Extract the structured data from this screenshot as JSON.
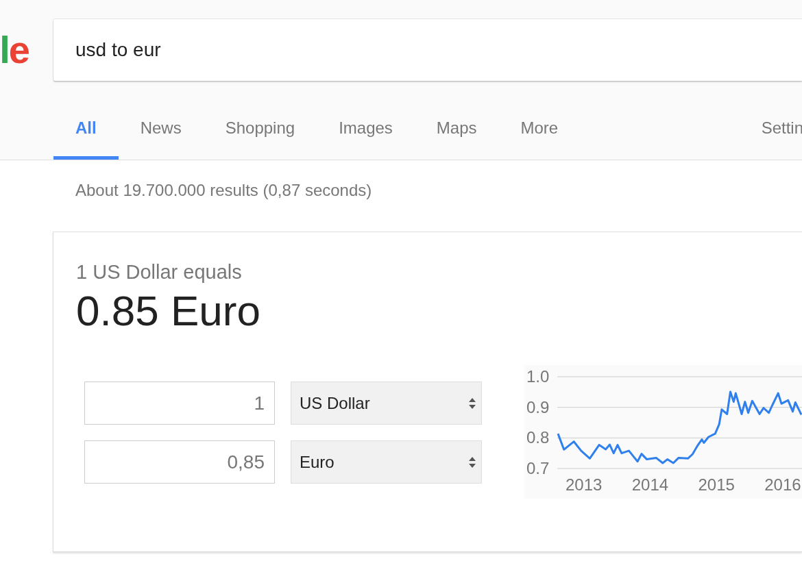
{
  "logo": {
    "text": "le"
  },
  "search": {
    "value": "usd to eur"
  },
  "tabs": [
    {
      "label": "All",
      "selected": true
    },
    {
      "label": "News",
      "selected": false
    },
    {
      "label": "Shopping",
      "selected": false
    },
    {
      "label": "Images",
      "selected": false
    },
    {
      "label": "Maps",
      "selected": false
    },
    {
      "label": "More",
      "selected": false
    }
  ],
  "settings": "Settin",
  "result_stats": "About 19.700.000 results (0,87 seconds)",
  "converter": {
    "equals": "1 US Dollar equals",
    "result": "0.85 Euro",
    "rows": [
      {
        "amount": "1",
        "currency": "US Dollar"
      },
      {
        "amount": "0,85",
        "currency": "Euro"
      }
    ],
    "chart_data": {
      "type": "line",
      "xlim": [
        2012.6,
        2016.29
      ],
      "ylim": [
        0.7,
        1.0
      ],
      "xticks": [
        2013,
        2014,
        2015,
        {
          "value": 2016,
          "label": "2016"
        }
      ],
      "yticks": [
        {
          "value": 0.7,
          "label": "0.7"
        },
        {
          "value": 0.8,
          "label": "0.8"
        },
        {
          "value": 0.9,
          "label": "0.9"
        },
        {
          "value": 1.0,
          "label": "1.0"
        }
      ],
      "x": [
        2012.61,
        2012.7,
        2012.85,
        2012.96,
        2013.09,
        2013.23,
        2013.33,
        2013.39,
        2013.45,
        2013.51,
        2013.57,
        2013.68,
        2013.75,
        2013.81,
        2013.87,
        2013.95,
        2014.09,
        2014.19,
        2014.26,
        2014.35,
        2014.43,
        2014.57,
        2014.64,
        2014.71,
        2014.78,
        2014.81,
        2014.88,
        2014.98,
        2015.04,
        2015.08,
        2015.16,
        2015.21,
        2015.26,
        2015.29,
        2015.38,
        2015.43,
        2015.48,
        2015.54,
        2015.65,
        2015.71,
        2015.79,
        2015.84,
        2015.93,
        2015.98,
        2016.08,
        2016.15,
        2016.19,
        2016.28
      ],
      "series": [
        {
          "color": "#2f80ed",
          "values": [
            0.814,
            0.762,
            0.788,
            0.758,
            0.733,
            0.777,
            0.763,
            0.778,
            0.75,
            0.777,
            0.75,
            0.758,
            0.739,
            0.723,
            0.748,
            0.73,
            0.735,
            0.718,
            0.73,
            0.718,
            0.735,
            0.733,
            0.747,
            0.773,
            0.795,
            0.784,
            0.803,
            0.814,
            0.844,
            0.893,
            0.878,
            0.951,
            0.918,
            0.946,
            0.878,
            0.918,
            0.882,
            0.921,
            0.878,
            0.898,
            0.882,
            0.906,
            0.946,
            0.912,
            0.923,
            0.886,
            0.916,
            0.876
          ]
        }
      ]
    }
  }
}
